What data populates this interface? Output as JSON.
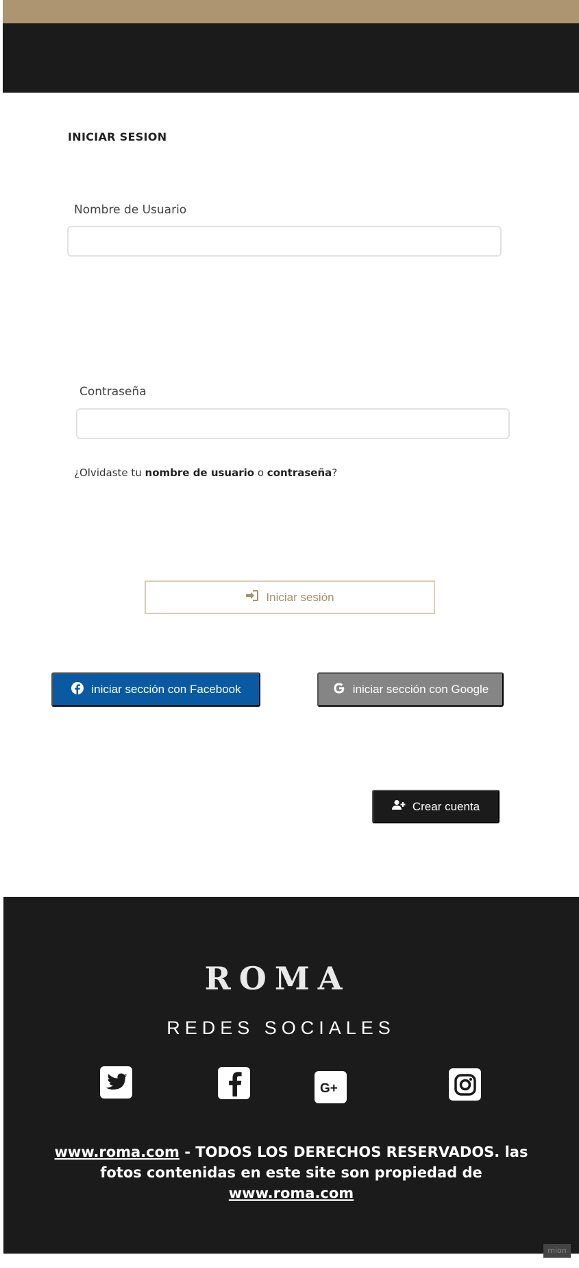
{
  "login": {
    "title": "INICIAR SESION",
    "username_label": "Nombre de Usuario",
    "username_value": "",
    "password_label": "Contraseña",
    "password_value": "",
    "forgot_prefix": "¿Olvidaste tu ",
    "forgot_username": "nombre de usuario",
    "forgot_or": " o ",
    "forgot_password": "contraseña",
    "forgot_suffix": "?",
    "submit_label": "Iniciar sesión",
    "facebook_label": "iniciar sección con Facebook",
    "google_label": "iniciar sección con Google",
    "create_account_label": "Crear cuenta"
  },
  "footer": {
    "brand": "ROMA",
    "social_heading": "REDES SOCIALES",
    "social_icons": [
      "twitter-icon",
      "facebook-icon",
      "google-plus-icon",
      "instagram-icon"
    ],
    "copyright_link": "www.roma.com",
    "copyright_text": " - TODOS LOS DERECHOS RESERVADOS. las fotos contenidas en este site son propiedad de ",
    "copyright_link2": "www.roma.com"
  },
  "badge": "mion",
  "colors": {
    "gold": "#ac9570",
    "dark": "#1b1b1b",
    "facebook": "#0a5aa3",
    "google": "#858585"
  }
}
